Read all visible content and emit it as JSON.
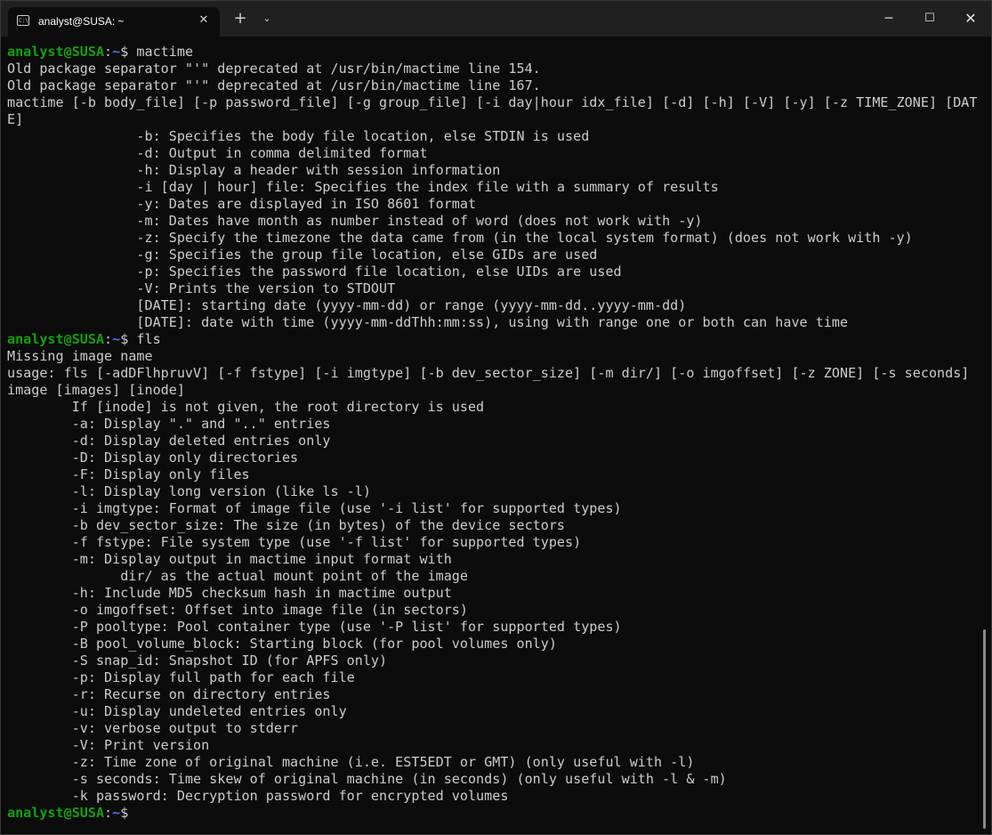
{
  "window": {
    "tab_title": "analyst@SUSA: ~",
    "tab_icon_text": "C:\\",
    "close_tab_glyph": "✕",
    "new_tab_glyph": "+",
    "dropdown_glyph": "⌄",
    "minimize_glyph": "─",
    "maximize_glyph": "☐",
    "close_glyph": "✕"
  },
  "colors": {
    "prompt_user": "#13a10e",
    "prompt_path": "#3b78ff",
    "text": "#cccccc",
    "background": "#0c0c0c",
    "titlebar": "#202020"
  },
  "prompt": {
    "user_host": "analyst@SUSA",
    "colon": ":",
    "path": "~",
    "dollar": "$"
  },
  "terminal": {
    "blocks": [
      {
        "command": " mactime",
        "output": [
          "Old package separator \"'\" deprecated at /usr/bin/mactime line 154.",
          "Old package separator \"'\" deprecated at /usr/bin/mactime line 167.",
          "mactime [-b body_file] [-p password_file] [-g group_file] [-i day|hour idx_file] [-d] [-h] [-V] [-y] [-z TIME_ZONE] [DAT",
          "E]",
          "                -b: Specifies the body file location, else STDIN is used",
          "                -d: Output in comma delimited format",
          "                -h: Display a header with session information",
          "                -i [day | hour] file: Specifies the index file with a summary of results",
          "                -y: Dates are displayed in ISO 8601 format",
          "                -m: Dates have month as number instead of word (does not work with -y)",
          "                -z: Specify the timezone the data came from (in the local system format) (does not work with -y)",
          "                -g: Specifies the group file location, else GIDs are used",
          "                -p: Specifies the password file location, else UIDs are used",
          "                -V: Prints the version to STDOUT",
          "                [DATE]: starting date (yyyy-mm-dd) or range (yyyy-mm-dd..yyyy-mm-dd)",
          "                [DATE]: date with time (yyyy-mm-ddThh:mm:ss), using with range one or both can have time"
        ]
      },
      {
        "command": " fls",
        "output": [
          "Missing image name",
          "usage: fls [-adDFlhpruvV] [-f fstype] [-i imgtype] [-b dev_sector_size] [-m dir/] [-o imgoffset] [-z ZONE] [-s seconds]",
          "image [images] [inode]",
          "        If [inode] is not given, the root directory is used",
          "        -a: Display \".\" and \"..\" entries",
          "        -d: Display deleted entries only",
          "        -D: Display only directories",
          "        -F: Display only files",
          "        -l: Display long version (like ls -l)",
          "        -i imgtype: Format of image file (use '-i list' for supported types)",
          "        -b dev_sector_size: The size (in bytes) of the device sectors",
          "        -f fstype: File system type (use '-f list' for supported types)",
          "        -m: Display output in mactime input format with",
          "              dir/ as the actual mount point of the image",
          "        -h: Include MD5 checksum hash in mactime output",
          "        -o imgoffset: Offset into image file (in sectors)",
          "        -P pooltype: Pool container type (use '-P list' for supported types)",
          "        -B pool_volume_block: Starting block (for pool volumes only)",
          "        -S snap_id: Snapshot ID (for APFS only)",
          "        -p: Display full path for each file",
          "        -r: Recurse on directory entries",
          "        -u: Display undeleted entries only",
          "        -v: verbose output to stderr",
          "        -V: Print version",
          "        -z: Time zone of original machine (i.e. EST5EDT or GMT) (only useful with -l)",
          "        -s seconds: Time skew of original machine (in seconds) (only useful with -l & -m)",
          "        -k password: Decryption password for encrypted volumes"
        ]
      },
      {
        "command": "",
        "output": []
      }
    ]
  }
}
